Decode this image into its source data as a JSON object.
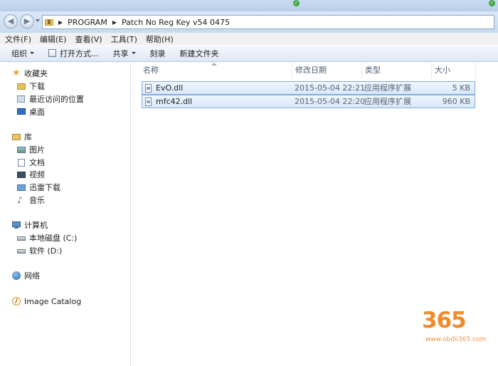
{
  "address": {
    "crumbs": [
      "PROGRAM",
      "Patch No Reg Key v54 0475"
    ]
  },
  "menu": [
    "文件(F)",
    "编辑(E)",
    "查看(V)",
    "工具(T)",
    "帮助(H)"
  ],
  "toolbar": {
    "organize": "组织",
    "open_with": "打开方式...",
    "share": "共享",
    "burn": "刻录",
    "new_folder": "新建文件夹"
  },
  "nav": {
    "favorites": "收藏夹",
    "downloads": "下载",
    "recent": "最近访问的位置",
    "desktop": "桌面",
    "libraries": "库",
    "pictures": "图片",
    "documents": "文档",
    "videos": "视频",
    "thunder": "迅雷下载",
    "music": "音乐",
    "computer": "计算机",
    "drive_c": "本地磁盘 (C:)",
    "drive_d": "软件 (D:)",
    "network": "网络",
    "image_catalog": "Image Catalog"
  },
  "columns": {
    "name": "名称",
    "modified": "修改日期",
    "type": "类型",
    "size": "大小"
  },
  "files": [
    {
      "name": "EvO.dll",
      "modified": "2015-05-04 22:21",
      "type": "应用程序扩展",
      "size": "5 KB"
    },
    {
      "name": "mfc42.dll",
      "modified": "2015-05-04 22:20",
      "type": "应用程序扩展",
      "size": "960 KB"
    }
  ],
  "watermark": {
    "digits": "365",
    "url": "www.obdii365.com"
  }
}
